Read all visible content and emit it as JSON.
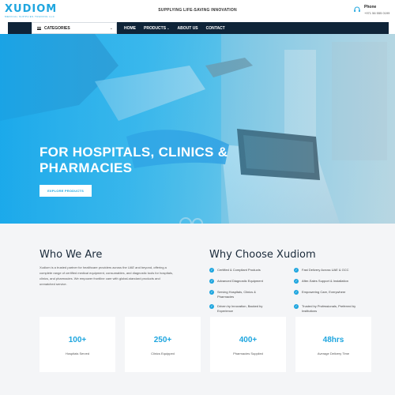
{
  "header": {
    "logo_word": "XUDIOM",
    "logo_sub": "MEDICAL SUPPLIES TRADING LLC",
    "tagline": "SUPPLYING LIFE-SAVING INNOVATION",
    "phone_label": "Phone",
    "phone_number": "+971 56 555 0199"
  },
  "nav": {
    "categories_label": "CATEGORIES",
    "items": [
      "HOME",
      "PRODUCTS",
      "ABOUT US",
      "CONTACT"
    ]
  },
  "hero": {
    "title": "FOR HOSPITALS, CLINICS & PHARMACIES",
    "button": "EXPLORE PRODUCTS"
  },
  "who": {
    "title": "Who We Are",
    "text": "Xudiom is a trusted partner for healthcare providers across the UAE and beyond, offering a complete range of certified medical equipment, consumables, and diagnostic tools for hospitals, clinics, and pharmacies. We empower frontline care with global-standard products and unmatched service."
  },
  "why": {
    "title": "Why Choose Xudiom",
    "features": [
      "Certified & Compliant Products",
      "Fast Delivery Across UAE & GCC",
      "Advanced Diagnostic Equipment",
      "After-Sales Support & Installation",
      "Serving Hospitals, Clinics & Pharmacies",
      "Empowering Care, Everywhere",
      "Driven by Innovation, Backed by Experience",
      "Trusted by Professionals, Preferred by Institutions"
    ]
  },
  "stats": [
    {
      "value": "100+",
      "label": "Hospitals Served"
    },
    {
      "value": "250+",
      "label": "Clinics Equipped"
    },
    {
      "value": "400+",
      "label": "Pharmacies Supplied"
    },
    {
      "value": "48hrs",
      "label": "Average Delivery Time"
    }
  ],
  "colors": {
    "accent": "#1fa6df",
    "nav_bg": "#0f2438",
    "section_bg": "#f4f5f7"
  }
}
